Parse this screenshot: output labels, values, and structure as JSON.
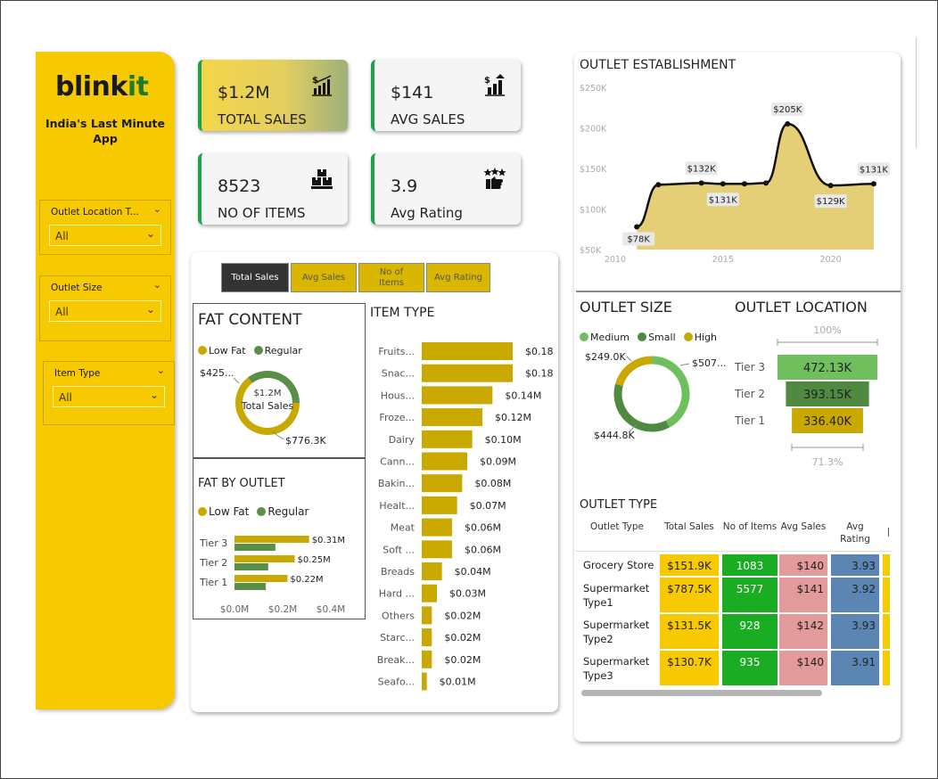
{
  "brand": {
    "name_main": "blink",
    "name_accent": "it",
    "tagline": "India's Last Minute App"
  },
  "slicers": [
    {
      "title": "Outlet Location T...",
      "value": "All"
    },
    {
      "title": "Outlet Size",
      "value": "All"
    },
    {
      "title": "Item Type",
      "value": "All"
    }
  ],
  "kpis": [
    {
      "value": "$1.2M",
      "label": "TOTAL SALES",
      "icon": "sales-growth-icon"
    },
    {
      "value": "$141",
      "label": "AVG SALES",
      "icon": "avg-sales-icon"
    },
    {
      "value": "8523",
      "label": "NO OF ITEMS",
      "icon": "boxes-icon"
    },
    {
      "value": "3.9",
      "label": "Avg Rating",
      "icon": "rating-icon"
    }
  ],
  "metric_tabs": [
    "Total Sales",
    "Avg Sales",
    "No of Items",
    "Avg Rating"
  ],
  "colors": {
    "yellow": "#f7c900",
    "gold": "#c9a800",
    "green": "#5a8f4a",
    "light_green": "#6fbf5f",
    "table_green": "#1aad24",
    "table_pink": "#e39a9a",
    "table_blue": "#5b86b3"
  },
  "chart_data": [
    {
      "id": "fat_content",
      "type": "pie",
      "title": "FAT CONTENT",
      "legend": [
        "Low Fat",
        "Regular"
      ],
      "center_value": "$1.2M",
      "center_label": "Total Sales",
      "series": [
        {
          "name": "Low Fat",
          "value": 776.3,
          "label": "$776.3K",
          "color": "#c9a800"
        },
        {
          "name": "Regular",
          "value": 425.4,
          "label": "$425...",
          "color": "#5a8f4a"
        }
      ]
    },
    {
      "id": "fat_by_outlet",
      "type": "bar",
      "title": "FAT BY OUTLET",
      "legend": [
        "Low Fat",
        "Regular"
      ],
      "categories": [
        "Tier 3",
        "Tier 2",
        "Tier 1"
      ],
      "series": [
        {
          "name": "Low Fat",
          "values": [
            0.31,
            0.25,
            0.22
          ],
          "labels": [
            "$0.31M",
            "$0.25M",
            "$0.22M"
          ],
          "color": "#c9a800"
        },
        {
          "name": "Regular",
          "values": [
            0.17,
            0.14,
            0.13
          ],
          "color": "#5a8f4a"
        }
      ],
      "x_ticks": [
        "$0.0M",
        "$0.2M",
        "$0.4M"
      ],
      "xlim": [
        0,
        0.4
      ]
    },
    {
      "id": "item_type",
      "type": "bar",
      "title": "ITEM TYPE",
      "categories": [
        "Fruits...",
        "Snac...",
        "Hous...",
        "Froze...",
        "Dairy",
        "Cann...",
        "Bakin...",
        "Healt...",
        "Meat",
        "Soft ...",
        "Breads",
        "Hard ...",
        "Others",
        "Starc...",
        "Break...",
        "Seafo..."
      ],
      "values": [
        0.18,
        0.18,
        0.14,
        0.12,
        0.1,
        0.09,
        0.08,
        0.07,
        0.06,
        0.06,
        0.04,
        0.03,
        0.02,
        0.02,
        0.02,
        0.01
      ],
      "labels": [
        "$0.18M",
        "$0.18M",
        "$0.14M",
        "$0.12M",
        "$0.10M",
        "$0.09M",
        "$0.08M",
        "$0.07M",
        "$0.06M",
        "$0.06M",
        "$0.04M",
        "$0.03M",
        "$0.02M",
        "$0.02M",
        "$0.02M",
        "$0.01M"
      ],
      "color": "#c9a800"
    },
    {
      "id": "outlet_establishment",
      "type": "area",
      "title": "OUTLET ESTABLISHMENT",
      "x": [
        2011,
        2012,
        2014,
        2015,
        2016,
        2017,
        2018,
        2020,
        2022
      ],
      "values": [
        78,
        130,
        132,
        131,
        131,
        132,
        205,
        129,
        131
      ],
      "point_labels": [
        "$78K",
        "",
        "$132K",
        "$131K",
        "",
        "",
        "$205K",
        "$129K",
        "$131K"
      ],
      "y_ticks": [
        "$50K",
        "$100K",
        "$150K",
        "$200K",
        "$250K"
      ],
      "x_ticks": [
        "2010",
        "2015",
        "2020"
      ],
      "ylim": [
        50,
        250
      ],
      "xlim": [
        2010,
        2022.5
      ]
    },
    {
      "id": "outlet_size",
      "type": "pie",
      "title": "OUTLET SIZE",
      "legend": [
        "Medium",
        "Small",
        "High"
      ],
      "series": [
        {
          "name": "Medium",
          "value": 507.9,
          "label": "$507...",
          "color": "#6fbf5f"
        },
        {
          "name": "Small",
          "value": 444.8,
          "label": "$444.8K",
          "color": "#4f8a40"
        },
        {
          "name": "High",
          "value": 249.0,
          "label": "$249.0K",
          "color": "#c9a800"
        }
      ]
    },
    {
      "id": "outlet_location",
      "type": "bar",
      "title": "OUTLET LOCATION",
      "categories": [
        "Tier 3",
        "Tier 2",
        "Tier 1"
      ],
      "values": [
        472.13,
        393.15,
        336.4
      ],
      "labels": [
        "472.13K",
        "393.15K",
        "336.40K"
      ],
      "colors": [
        "#6fbf5f",
        "#4f8a40",
        "#c9a800"
      ],
      "top_pct": "100%",
      "bottom_pct": "71.3%"
    },
    {
      "id": "outlet_type",
      "type": "table",
      "title": "OUTLET TYPE",
      "columns": [
        "Outlet Type",
        "Total Sales",
        "No of Items",
        "Avg Sales",
        "Avg Rating"
      ],
      "rows": [
        [
          "Grocery Store",
          "$151.9K",
          "1083",
          "$140",
          "3.93"
        ],
        [
          "Supermarket Type1",
          "$787.5K",
          "5577",
          "$141",
          "3.92"
        ],
        [
          "Supermarket Type2",
          "$131.5K",
          "928",
          "$142",
          "3.93"
        ],
        [
          "Supermarket Type3",
          "$130.7K",
          "935",
          "$140",
          "3.91"
        ]
      ]
    }
  ]
}
